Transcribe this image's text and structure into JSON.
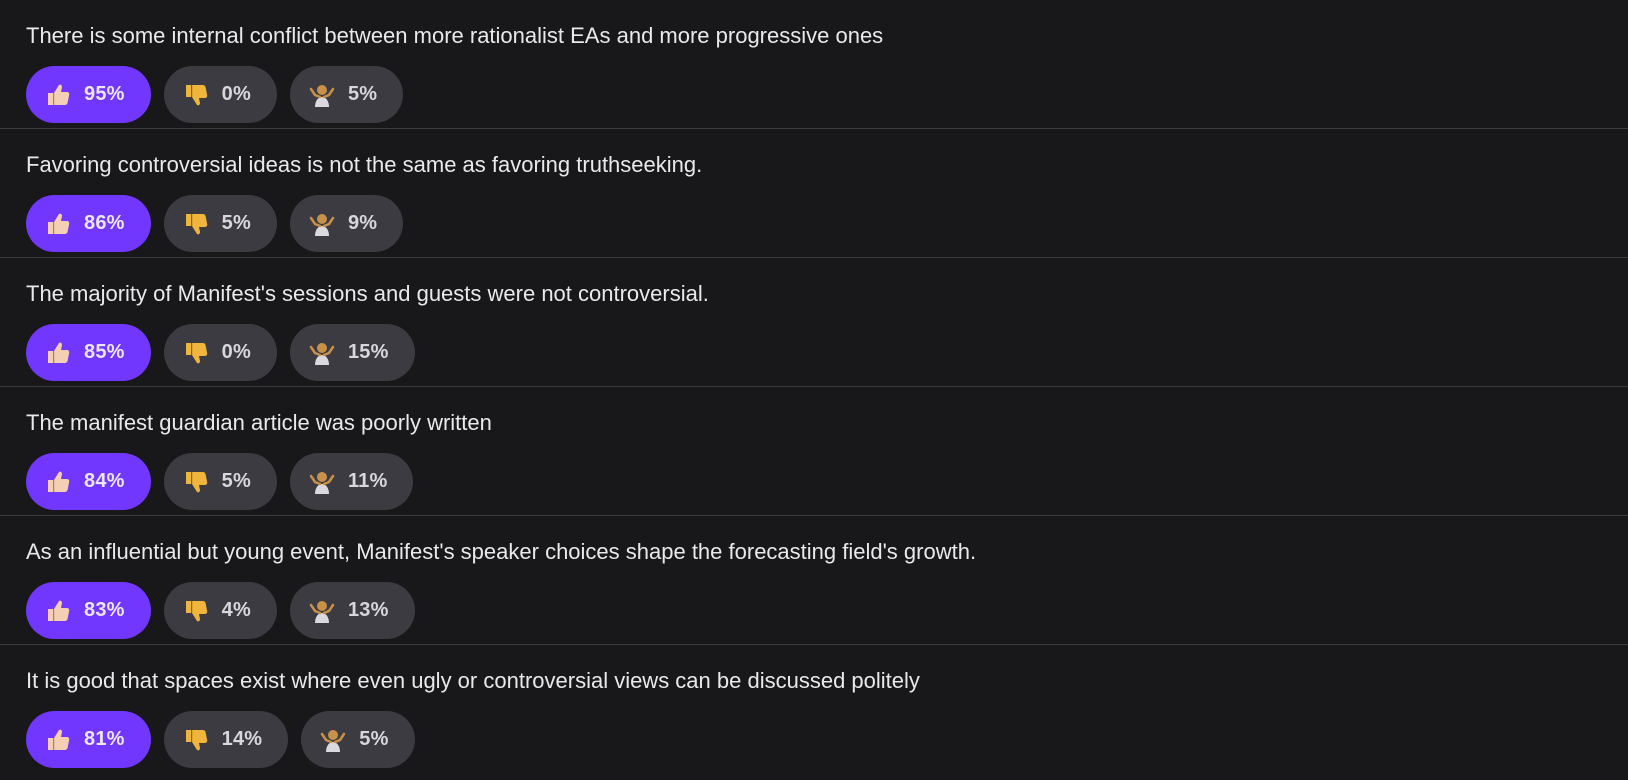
{
  "statements": [
    {
      "text": "There is some internal conflict between more rationalist EAs and more progressive ones",
      "agree": "95%",
      "disagree": "0%",
      "unsure": "5%"
    },
    {
      "text": "Favoring controversial ideas is not the same as favoring truthseeking.",
      "agree": "86%",
      "disagree": "5%",
      "unsure": "9%"
    },
    {
      "text": "The majority of Manifest's sessions and guests were not controversial.",
      "agree": "85%",
      "disagree": "0%",
      "unsure": "15%"
    },
    {
      "text": "The manifest guardian article was poorly written",
      "agree": "84%",
      "disagree": "5%",
      "unsure": "11%"
    },
    {
      "text": "As an influential but young event, Manifest's speaker choices shape the forecasting field's growth.",
      "agree": "83%",
      "disagree": "4%",
      "unsure": "13%"
    },
    {
      "text": "It is good that spaces exist where even ugly or controversial views can be discussed politely",
      "agree": "81%",
      "disagree": "14%",
      "unsure": "5%"
    }
  ],
  "icons": {
    "agree": "thumbs-up-icon",
    "disagree": "thumbs-down-icon",
    "unsure": "shrug-icon"
  },
  "colors": {
    "background": "#18181b",
    "agree_pill": "#7137ff",
    "neutral_pill": "#3b3b41",
    "divider": "#3a3a3f"
  }
}
